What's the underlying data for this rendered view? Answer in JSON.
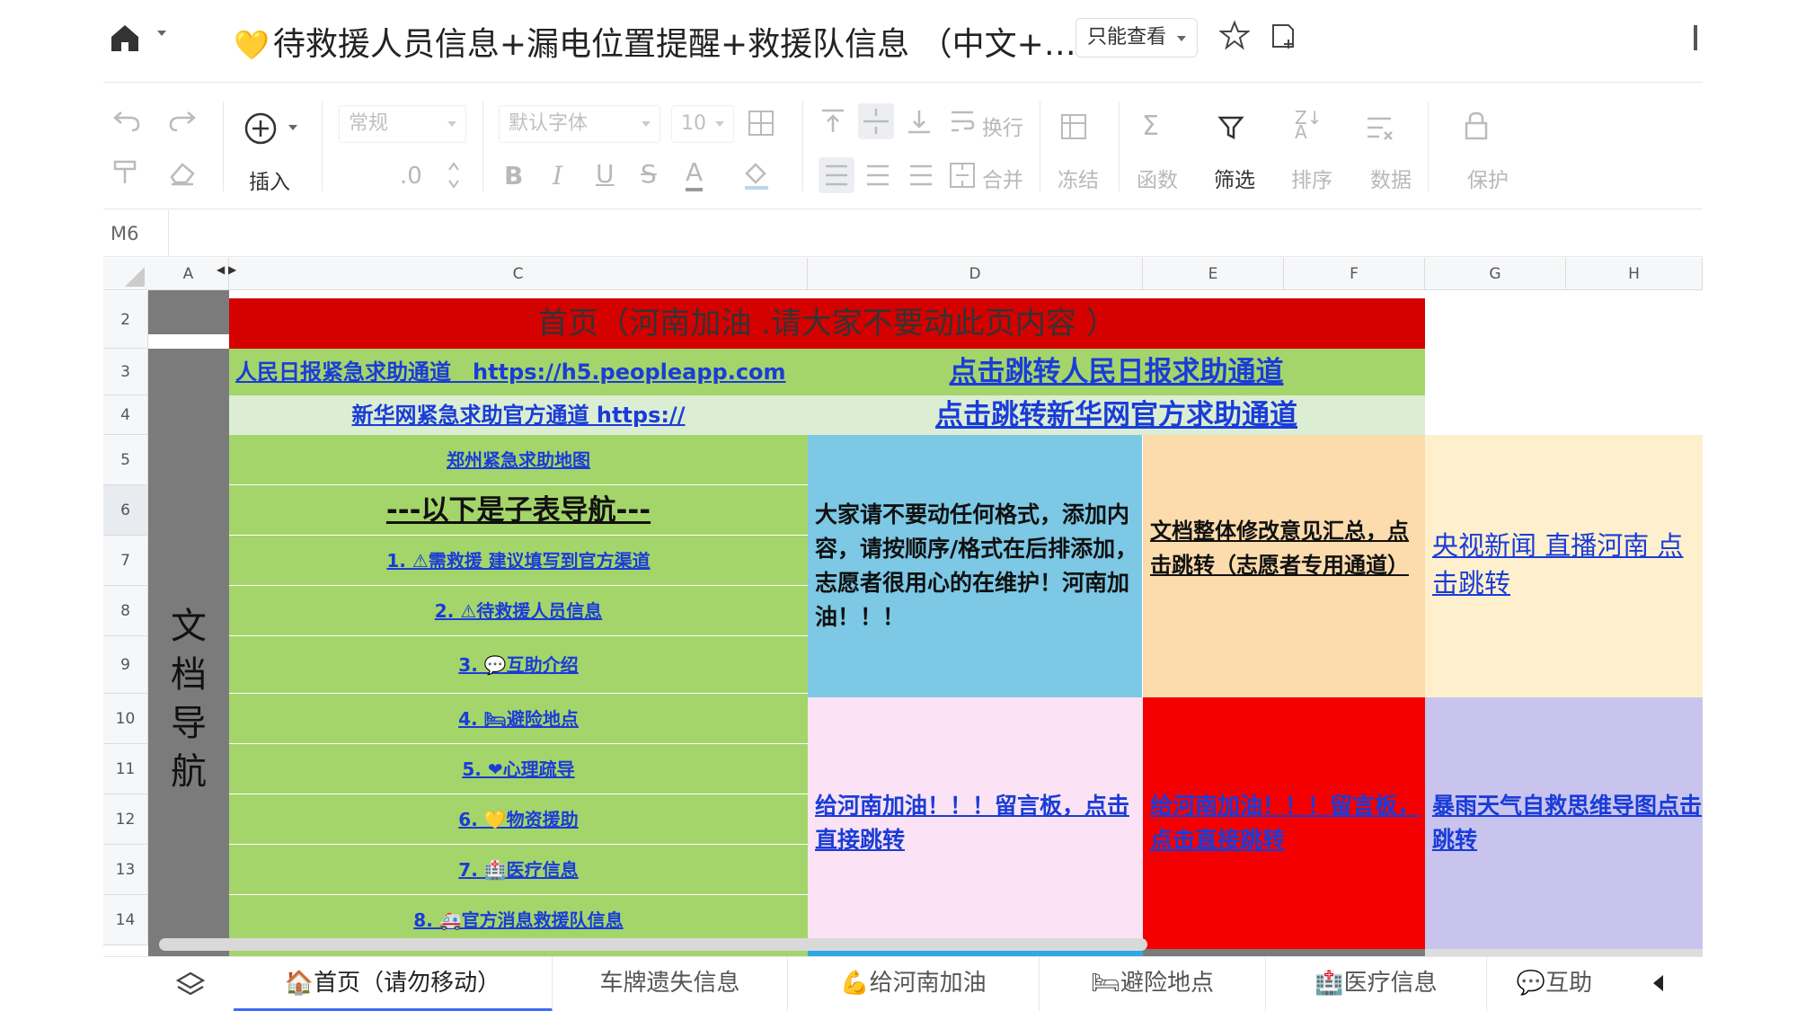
{
  "titlebar": {
    "title": "待救援人员信息+漏电位置提醒+救援队信息 （中文+…",
    "mode": "只能查看"
  },
  "toolbar": {
    "insert": "插入",
    "number_format": "常规",
    "decimal": ".0",
    "font": "默认字体",
    "font_size": "10",
    "wrap": "换行",
    "merge": "合并",
    "freeze": "冻结",
    "function": "函数",
    "filter": "筛选",
    "sort": "排序",
    "data": "数据",
    "protect": "保护"
  },
  "formula_bar": {
    "cell_ref": "M6"
  },
  "columns": [
    "A",
    "C",
    "D",
    "E",
    "F",
    "G",
    "H"
  ],
  "rows": [
    "2",
    "3",
    "4",
    "5",
    "6",
    "7",
    "8",
    "9",
    "10",
    "11",
    "12",
    "13",
    "14"
  ],
  "sheet": {
    "banner": "首页（河南加油 .请大家不要动此页内容 ）",
    "nav_title": [
      "文",
      "档",
      "导",
      "航"
    ],
    "row3_left": "人民日报紧急求助通道　https://h5.peopleapp.com",
    "row3_right": "点击跳转人民日报求助通道",
    "row4_left": "新华网紧急求助官方通道 https://",
    "row4_right": "点击跳转新华网官方求助通道",
    "zhengzhou_map": "郑州紧急求助地图",
    "subnav_header": "---以下是子表导航---",
    "nav_items": [
      "1. ⚠需救援 建议填写到官方渠道",
      "2. ⚠待救援人员信息",
      "3. 💬互助介绍",
      "4. 🛏避险地点",
      "5. ❤心理疏导",
      "6. 💛物资援助",
      "7. 🏥医疗信息",
      "8. 🚑官方消息救援队信息"
    ],
    "notice": "大家请不要动任何格式，添加内容，请按顺序/格式在后排添加，志愿者很用心的在维护！河南加油！！！",
    "feedback_link": "文档整体修改意见汇总，点击跳转（志愿者专用通道）",
    "cctv_link": "央视新闻 直播河南 点击跳转",
    "message_board_1": "给河南加油！！！留言板，点击直接跳转",
    "message_board_2": "给河南加油！！！留言板，点击直接跳转",
    "rainstorm_link": "暴雨天气自救思维导图点击跳转"
  },
  "tabs": [
    "🏠首页（请勿移动）",
    "车牌遗失信息",
    "💪给河南加油",
    "🛏避险地点",
    "🏥医疗信息",
    "💬互助"
  ],
  "colors": {
    "banner": "#d50000",
    "green": "#a4d56a",
    "blue": "#7cc8e5",
    "peach": "#fcdcad",
    "pink": "#fbe3f5",
    "red": "#f50000",
    "lavender": "#c9c4ee",
    "link": "#1a3cd8"
  }
}
